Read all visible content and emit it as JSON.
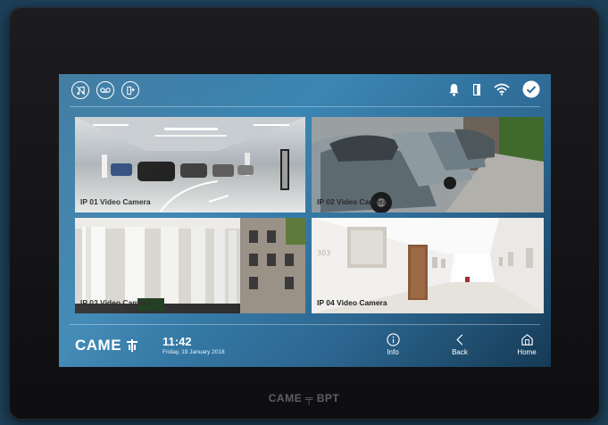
{
  "topbar": {
    "left_icons": [
      "music-note-icon",
      "voicemail-icon",
      "door-exchange-icon"
    ],
    "right_icons": [
      "bell-icon",
      "door-icon",
      "wifi-icon",
      "check-circle-icon"
    ]
  },
  "cameras": [
    {
      "label": "IP 01 Video Camera"
    },
    {
      "label": "IP 02 Video Camera"
    },
    {
      "label": "IP 03 Video Camera"
    },
    {
      "label": "IP 04 Video Camera"
    }
  ],
  "brand": "CAME",
  "clock": {
    "time": "11:42",
    "date": "Friday, 19 January 2018"
  },
  "nav": {
    "info": "Info",
    "back": "Back",
    "home": "Home"
  },
  "device_brand": "CAME ╤ BPT",
  "colors": {
    "accent": "#3b86b4",
    "bezel": "#141416"
  }
}
